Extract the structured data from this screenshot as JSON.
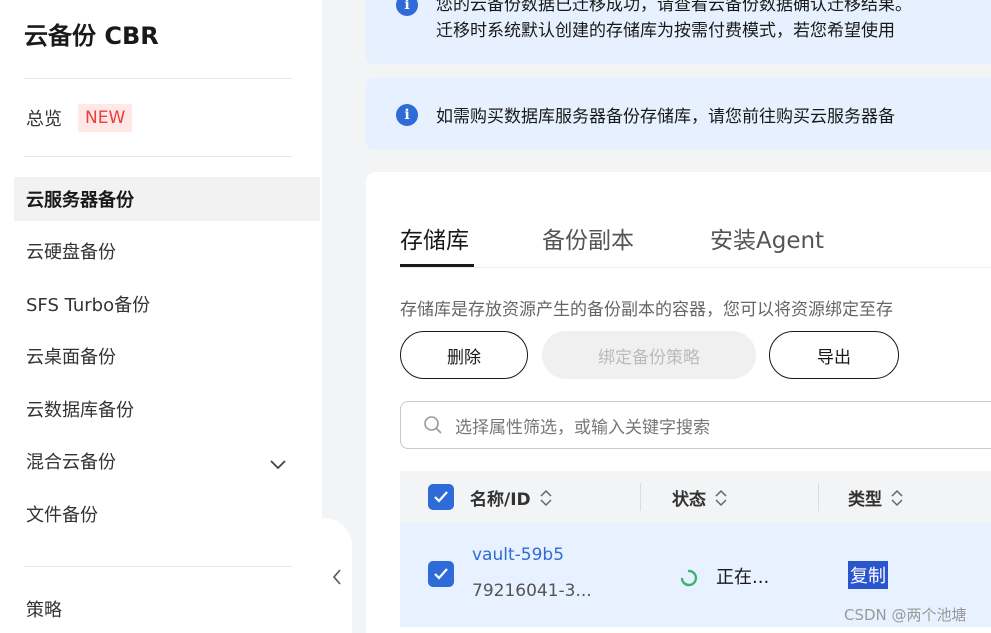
{
  "sidebar": {
    "title": "云备份 CBR",
    "overview": {
      "label": "总览",
      "badge": "NEW"
    },
    "items": [
      {
        "label": "云服务器备份"
      },
      {
        "label": "云硬盘备份"
      },
      {
        "label": "SFS Turbo备份"
      },
      {
        "label": "云桌面备份"
      },
      {
        "label": "云数据库备份"
      },
      {
        "label": "混合云备份"
      },
      {
        "label": "文件备份"
      }
    ],
    "policy_label": "策略"
  },
  "banners": [
    {
      "line1": "您的云备份数据已迁移成功，请查看云备份数据确认迁移结果。",
      "line2": "迁移时系统默认创建的存储库为按需付费模式，若您希望使用"
    },
    {
      "line1": "如需购买数据库服务器备份存储库，请您前往购买云服务器备"
    }
  ],
  "tabs": [
    {
      "label": "存储库"
    },
    {
      "label": "备份副本"
    },
    {
      "label": "安装Agent"
    }
  ],
  "description": "存储库是存放资源产生的备份副本的容器，您可以将资源绑定至存",
  "toolbar": {
    "delete_label": "删除",
    "bind_policy_label": "绑定备份策略",
    "export_label": "导出"
  },
  "search": {
    "placeholder": "选择属性筛选，或输入关键字搜索"
  },
  "table": {
    "columns": [
      "名称/ID",
      "状态",
      "类型"
    ],
    "rows": [
      {
        "name": "vault-59b5",
        "id": "79216041-3...",
        "status": "正在...",
        "type": "复制",
        "checked": true
      }
    ]
  },
  "watermark": "CSDN @两个池塘",
  "colors": {
    "accent": "#2e6bd8",
    "banner_bg": "#e6f0ff",
    "badge_text": "#e8403a",
    "badge_bg": "#ffe8e6",
    "spinner": "#3cb371"
  }
}
